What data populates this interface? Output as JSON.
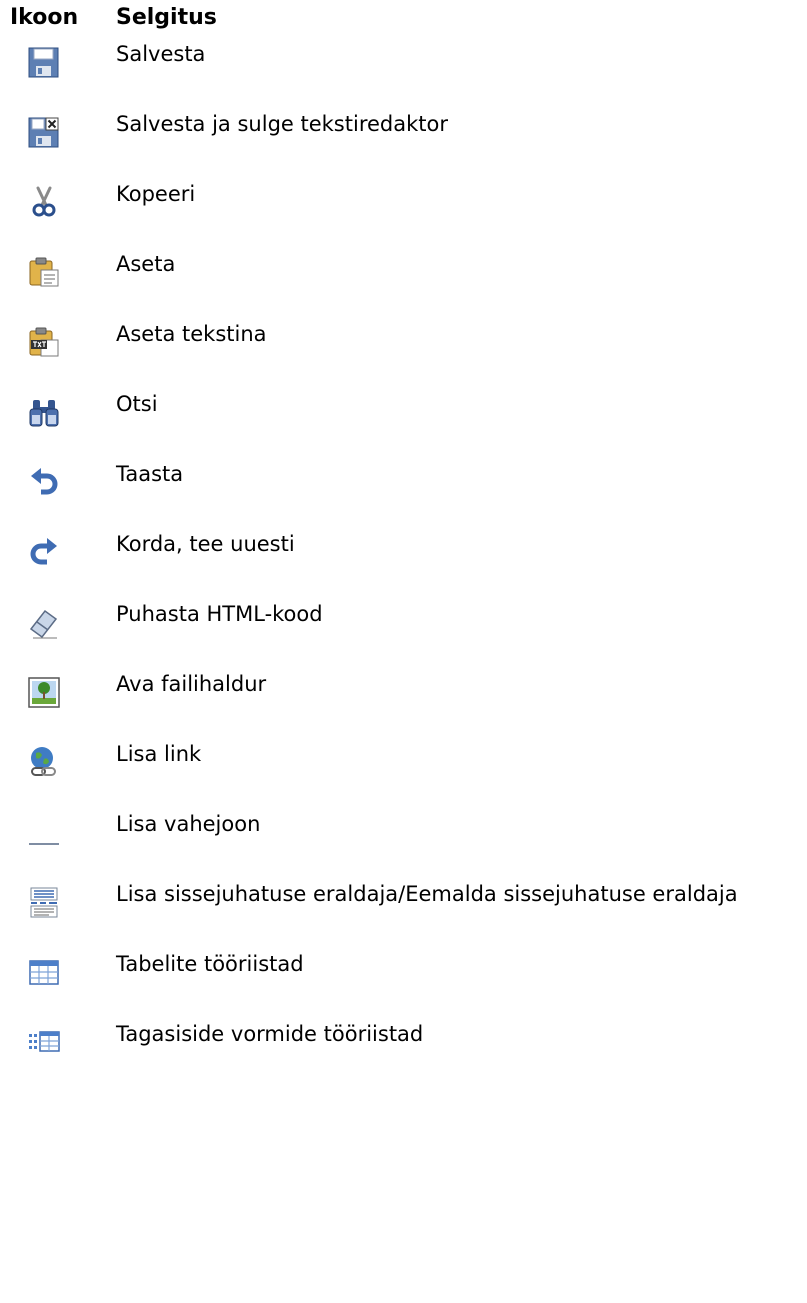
{
  "table": {
    "header_icon": "Ikoon",
    "header_explanation": "Selgitus",
    "rows": [
      {
        "icon": "save-icon",
        "label": "Salvesta"
      },
      {
        "icon": "save-close-icon",
        "label": "Salvesta ja sulge tekstiredaktor"
      },
      {
        "icon": "scissors-icon",
        "label": "Kopeeri"
      },
      {
        "icon": "paste-icon",
        "label": "Aseta"
      },
      {
        "icon": "paste-text-icon",
        "label": "Aseta tekstina"
      },
      {
        "icon": "binoculars-icon",
        "label": "Otsi"
      },
      {
        "icon": "undo-icon",
        "label": "Taasta"
      },
      {
        "icon": "redo-icon",
        "label": "Korda, tee uuesti"
      },
      {
        "icon": "eraser-icon",
        "label": "Puhasta HTML-kood"
      },
      {
        "icon": "image-icon",
        "label": "Ava failihaldur"
      },
      {
        "icon": "link-icon",
        "label": "Lisa link"
      },
      {
        "icon": "horizontal-rule-icon",
        "label": "Lisa vahejoon"
      },
      {
        "icon": "intro-separator-icon",
        "label": "Lisa sissejuhatuse eraldaja/Eemalda sissejuhatuse eraldaja"
      },
      {
        "icon": "table-icon",
        "label": "Tabelite tööriistad"
      },
      {
        "icon": "form-icon",
        "label": "Tagasiside vormide tööriistad"
      }
    ]
  }
}
